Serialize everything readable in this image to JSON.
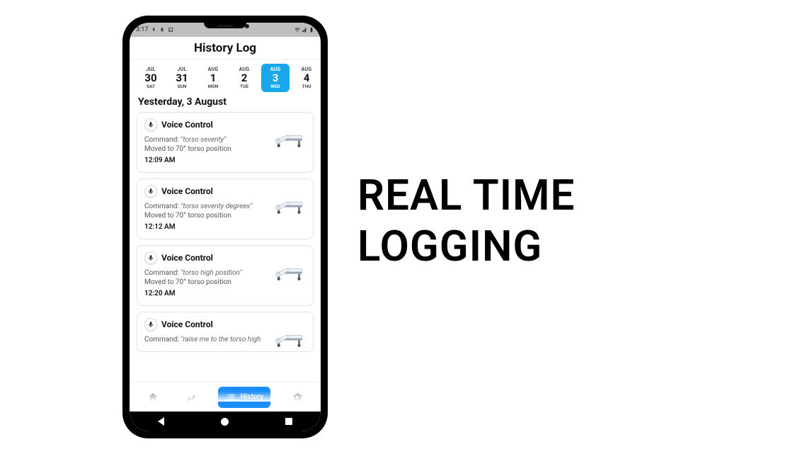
{
  "headline_line1": "REAL TIME",
  "headline_line2": "LOGGING",
  "statusbar": {
    "time": "3:17",
    "left_icons": [
      "bluetooth-icon",
      "mic-icon",
      "cast-icon"
    ],
    "right_icons": [
      "wifi-icon",
      "signal-icon",
      "battery-icon"
    ]
  },
  "app_title": "History Log",
  "dates": [
    {
      "month": "JUL",
      "day": "30",
      "weekday": "SAT",
      "selected": false
    },
    {
      "month": "JUL",
      "day": "31",
      "weekday": "SUN",
      "selected": false
    },
    {
      "month": "AUG",
      "day": "1",
      "weekday": "MON",
      "selected": false
    },
    {
      "month": "AUG",
      "day": "2",
      "weekday": "TUE",
      "selected": false
    },
    {
      "month": "AUG",
      "day": "3",
      "weekday": "WED",
      "selected": true
    },
    {
      "month": "AUG",
      "day": "4",
      "weekday": "THU",
      "selected": false
    }
  ],
  "day_header": "Yesterday, 3 August",
  "log_cards": [
    {
      "type": "Voice Control",
      "command_label": "Command:",
      "command": "\"torso seventy\"",
      "result": "Moved to 70° torso position",
      "time": "12:09 AM"
    },
    {
      "type": "Voice Control",
      "command_label": "Command:",
      "command": "\"torso seventy degrees\"",
      "result": "Moved to 70° torso position",
      "time": "12:12 AM"
    },
    {
      "type": "Voice Control",
      "command_label": "Command:",
      "command": "\"torso high position\"",
      "result": "Moved to 70° torso position",
      "time": "12:20 AM"
    },
    {
      "type": "Voice Control",
      "command_label": "Command:",
      "command": "\"raise me to the torso high",
      "result": "",
      "time": ""
    }
  ],
  "nav": {
    "home": {
      "label": "Home"
    },
    "trends": {
      "label": "Trends"
    },
    "history": {
      "label": "History"
    },
    "settings": {
      "label": "Settings"
    }
  }
}
